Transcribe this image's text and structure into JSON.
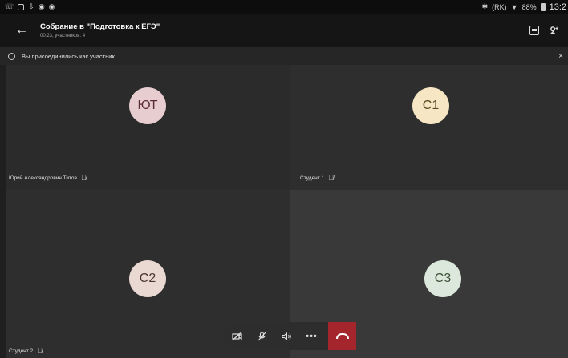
{
  "status_bar": {
    "time": "13:2",
    "battery_text": "88%",
    "signal_text": "(RK)"
  },
  "header": {
    "back_icon": "back-arrow-icon",
    "title": "Собрание в \"Подготовка к ЕГЭ\"",
    "subtitle": "00:23, участников: 4",
    "chat_icon": "chat-icon",
    "participants_icon": "add-participants-icon"
  },
  "banner": {
    "text": "Вы присоединились как участник.",
    "close": "×"
  },
  "participants": [
    {
      "initials": "ЮТ",
      "name": "Юрий Александрович Титов",
      "muted": true,
      "color": "#e8cdd0"
    },
    {
      "initials": "С1",
      "name": "Студент 1",
      "muted": true,
      "color": "#f6e6c4"
    },
    {
      "initials": "С2",
      "name": "Студент 2",
      "muted": true,
      "color": "#ead8d2"
    },
    {
      "initials": "С3",
      "name": "",
      "muted": false,
      "color": "#dde8dc"
    }
  ],
  "controls": {
    "camera_icon": "camera-off-icon",
    "mic_icon": "mic-off-icon",
    "speaker_icon": "speaker-icon",
    "more_icon": "more-icon",
    "hangup_icon": "hang-up-icon"
  },
  "colors": {
    "hangup": "#a4262c",
    "background": "#1f1f1f"
  }
}
